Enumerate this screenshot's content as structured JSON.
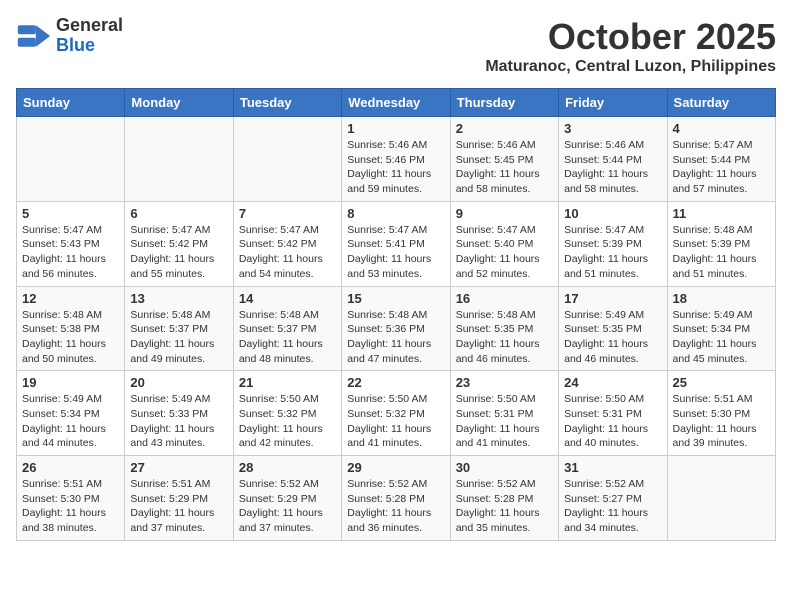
{
  "header": {
    "logo_line1": "General",
    "logo_line2": "Blue",
    "month": "October 2025",
    "location": "Maturanoc, Central Luzon, Philippines"
  },
  "weekdays": [
    "Sunday",
    "Monday",
    "Tuesday",
    "Wednesday",
    "Thursday",
    "Friday",
    "Saturday"
  ],
  "weeks": [
    [
      {
        "day": "",
        "info": ""
      },
      {
        "day": "",
        "info": ""
      },
      {
        "day": "",
        "info": ""
      },
      {
        "day": "1",
        "info": "Sunrise: 5:46 AM\nSunset: 5:46 PM\nDaylight: 11 hours\nand 59 minutes."
      },
      {
        "day": "2",
        "info": "Sunrise: 5:46 AM\nSunset: 5:45 PM\nDaylight: 11 hours\nand 58 minutes."
      },
      {
        "day": "3",
        "info": "Sunrise: 5:46 AM\nSunset: 5:44 PM\nDaylight: 11 hours\nand 58 minutes."
      },
      {
        "day": "4",
        "info": "Sunrise: 5:47 AM\nSunset: 5:44 PM\nDaylight: 11 hours\nand 57 minutes."
      }
    ],
    [
      {
        "day": "5",
        "info": "Sunrise: 5:47 AM\nSunset: 5:43 PM\nDaylight: 11 hours\nand 56 minutes."
      },
      {
        "day": "6",
        "info": "Sunrise: 5:47 AM\nSunset: 5:42 PM\nDaylight: 11 hours\nand 55 minutes."
      },
      {
        "day": "7",
        "info": "Sunrise: 5:47 AM\nSunset: 5:42 PM\nDaylight: 11 hours\nand 54 minutes."
      },
      {
        "day": "8",
        "info": "Sunrise: 5:47 AM\nSunset: 5:41 PM\nDaylight: 11 hours\nand 53 minutes."
      },
      {
        "day": "9",
        "info": "Sunrise: 5:47 AM\nSunset: 5:40 PM\nDaylight: 11 hours\nand 52 minutes."
      },
      {
        "day": "10",
        "info": "Sunrise: 5:47 AM\nSunset: 5:39 PM\nDaylight: 11 hours\nand 51 minutes."
      },
      {
        "day": "11",
        "info": "Sunrise: 5:48 AM\nSunset: 5:39 PM\nDaylight: 11 hours\nand 51 minutes."
      }
    ],
    [
      {
        "day": "12",
        "info": "Sunrise: 5:48 AM\nSunset: 5:38 PM\nDaylight: 11 hours\nand 50 minutes."
      },
      {
        "day": "13",
        "info": "Sunrise: 5:48 AM\nSunset: 5:37 PM\nDaylight: 11 hours\nand 49 minutes."
      },
      {
        "day": "14",
        "info": "Sunrise: 5:48 AM\nSunset: 5:37 PM\nDaylight: 11 hours\nand 48 minutes."
      },
      {
        "day": "15",
        "info": "Sunrise: 5:48 AM\nSunset: 5:36 PM\nDaylight: 11 hours\nand 47 minutes."
      },
      {
        "day": "16",
        "info": "Sunrise: 5:48 AM\nSunset: 5:35 PM\nDaylight: 11 hours\nand 46 minutes."
      },
      {
        "day": "17",
        "info": "Sunrise: 5:49 AM\nSunset: 5:35 PM\nDaylight: 11 hours\nand 46 minutes."
      },
      {
        "day": "18",
        "info": "Sunrise: 5:49 AM\nSunset: 5:34 PM\nDaylight: 11 hours\nand 45 minutes."
      }
    ],
    [
      {
        "day": "19",
        "info": "Sunrise: 5:49 AM\nSunset: 5:34 PM\nDaylight: 11 hours\nand 44 minutes."
      },
      {
        "day": "20",
        "info": "Sunrise: 5:49 AM\nSunset: 5:33 PM\nDaylight: 11 hours\nand 43 minutes."
      },
      {
        "day": "21",
        "info": "Sunrise: 5:50 AM\nSunset: 5:32 PM\nDaylight: 11 hours\nand 42 minutes."
      },
      {
        "day": "22",
        "info": "Sunrise: 5:50 AM\nSunset: 5:32 PM\nDaylight: 11 hours\nand 41 minutes."
      },
      {
        "day": "23",
        "info": "Sunrise: 5:50 AM\nSunset: 5:31 PM\nDaylight: 11 hours\nand 41 minutes."
      },
      {
        "day": "24",
        "info": "Sunrise: 5:50 AM\nSunset: 5:31 PM\nDaylight: 11 hours\nand 40 minutes."
      },
      {
        "day": "25",
        "info": "Sunrise: 5:51 AM\nSunset: 5:30 PM\nDaylight: 11 hours\nand 39 minutes."
      }
    ],
    [
      {
        "day": "26",
        "info": "Sunrise: 5:51 AM\nSunset: 5:30 PM\nDaylight: 11 hours\nand 38 minutes."
      },
      {
        "day": "27",
        "info": "Sunrise: 5:51 AM\nSunset: 5:29 PM\nDaylight: 11 hours\nand 37 minutes."
      },
      {
        "day": "28",
        "info": "Sunrise: 5:52 AM\nSunset: 5:29 PM\nDaylight: 11 hours\nand 37 minutes."
      },
      {
        "day": "29",
        "info": "Sunrise: 5:52 AM\nSunset: 5:28 PM\nDaylight: 11 hours\nand 36 minutes."
      },
      {
        "day": "30",
        "info": "Sunrise: 5:52 AM\nSunset: 5:28 PM\nDaylight: 11 hours\nand 35 minutes."
      },
      {
        "day": "31",
        "info": "Sunrise: 5:52 AM\nSunset: 5:27 PM\nDaylight: 11 hours\nand 34 minutes."
      },
      {
        "day": "",
        "info": ""
      }
    ]
  ]
}
